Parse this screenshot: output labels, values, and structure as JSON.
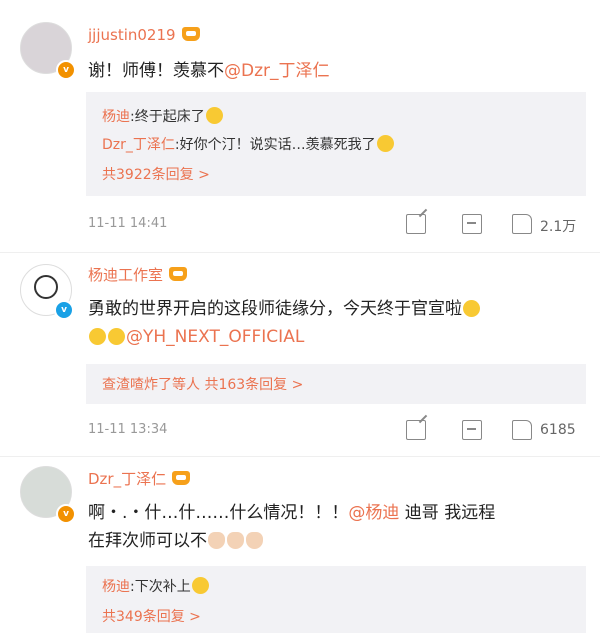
{
  "comments": [
    {
      "username": "jjjustin0219",
      "text_parts": [
        "谢！师傅！羡慕不",
        "@Dzr_丁泽仁"
      ],
      "replies": [
        {
          "user": "杨迪",
          "text": ":终于起床了"
        },
        {
          "user": "Dzr_丁泽仁",
          "text": ":好你个汀！说实话…羡慕死我了"
        }
      ],
      "reply_total": "共3922条回复 >",
      "time": "11-11 14:41",
      "likes": "2.1万"
    },
    {
      "username": "杨迪工作室",
      "text_line1": "勇敢的世界开启的这段师徒缘分，今天终于官宣啦",
      "text_line2_mention": "@YH_NEXT_OFFICIAL",
      "reply_summary": "查渣喳炸了等人  共163条回复 >",
      "time": "11-11 13:34",
      "likes": "6185"
    },
    {
      "username": "Dzr_丁泽仁",
      "text_line1_part1": "啊・.・什…什……什么情况！！！",
      "text_line1_mention": "@杨迪",
      "text_line1_part2": " 迪哥 我远程",
      "text_line2": "在拜次师可以不",
      "replies": [
        {
          "user": "杨迪",
          "text": ":下次补上"
        }
      ],
      "reply_total": "共349条回复 >"
    }
  ],
  "colors": {
    "accent": "#eb7350",
    "reply_bg": "#f2f2f5",
    "vip_badge": "#f29100",
    "verified_badge": "#1aa1e6"
  },
  "icons": [
    "share-icon",
    "comment-icon",
    "like-icon",
    "crown-icon"
  ]
}
